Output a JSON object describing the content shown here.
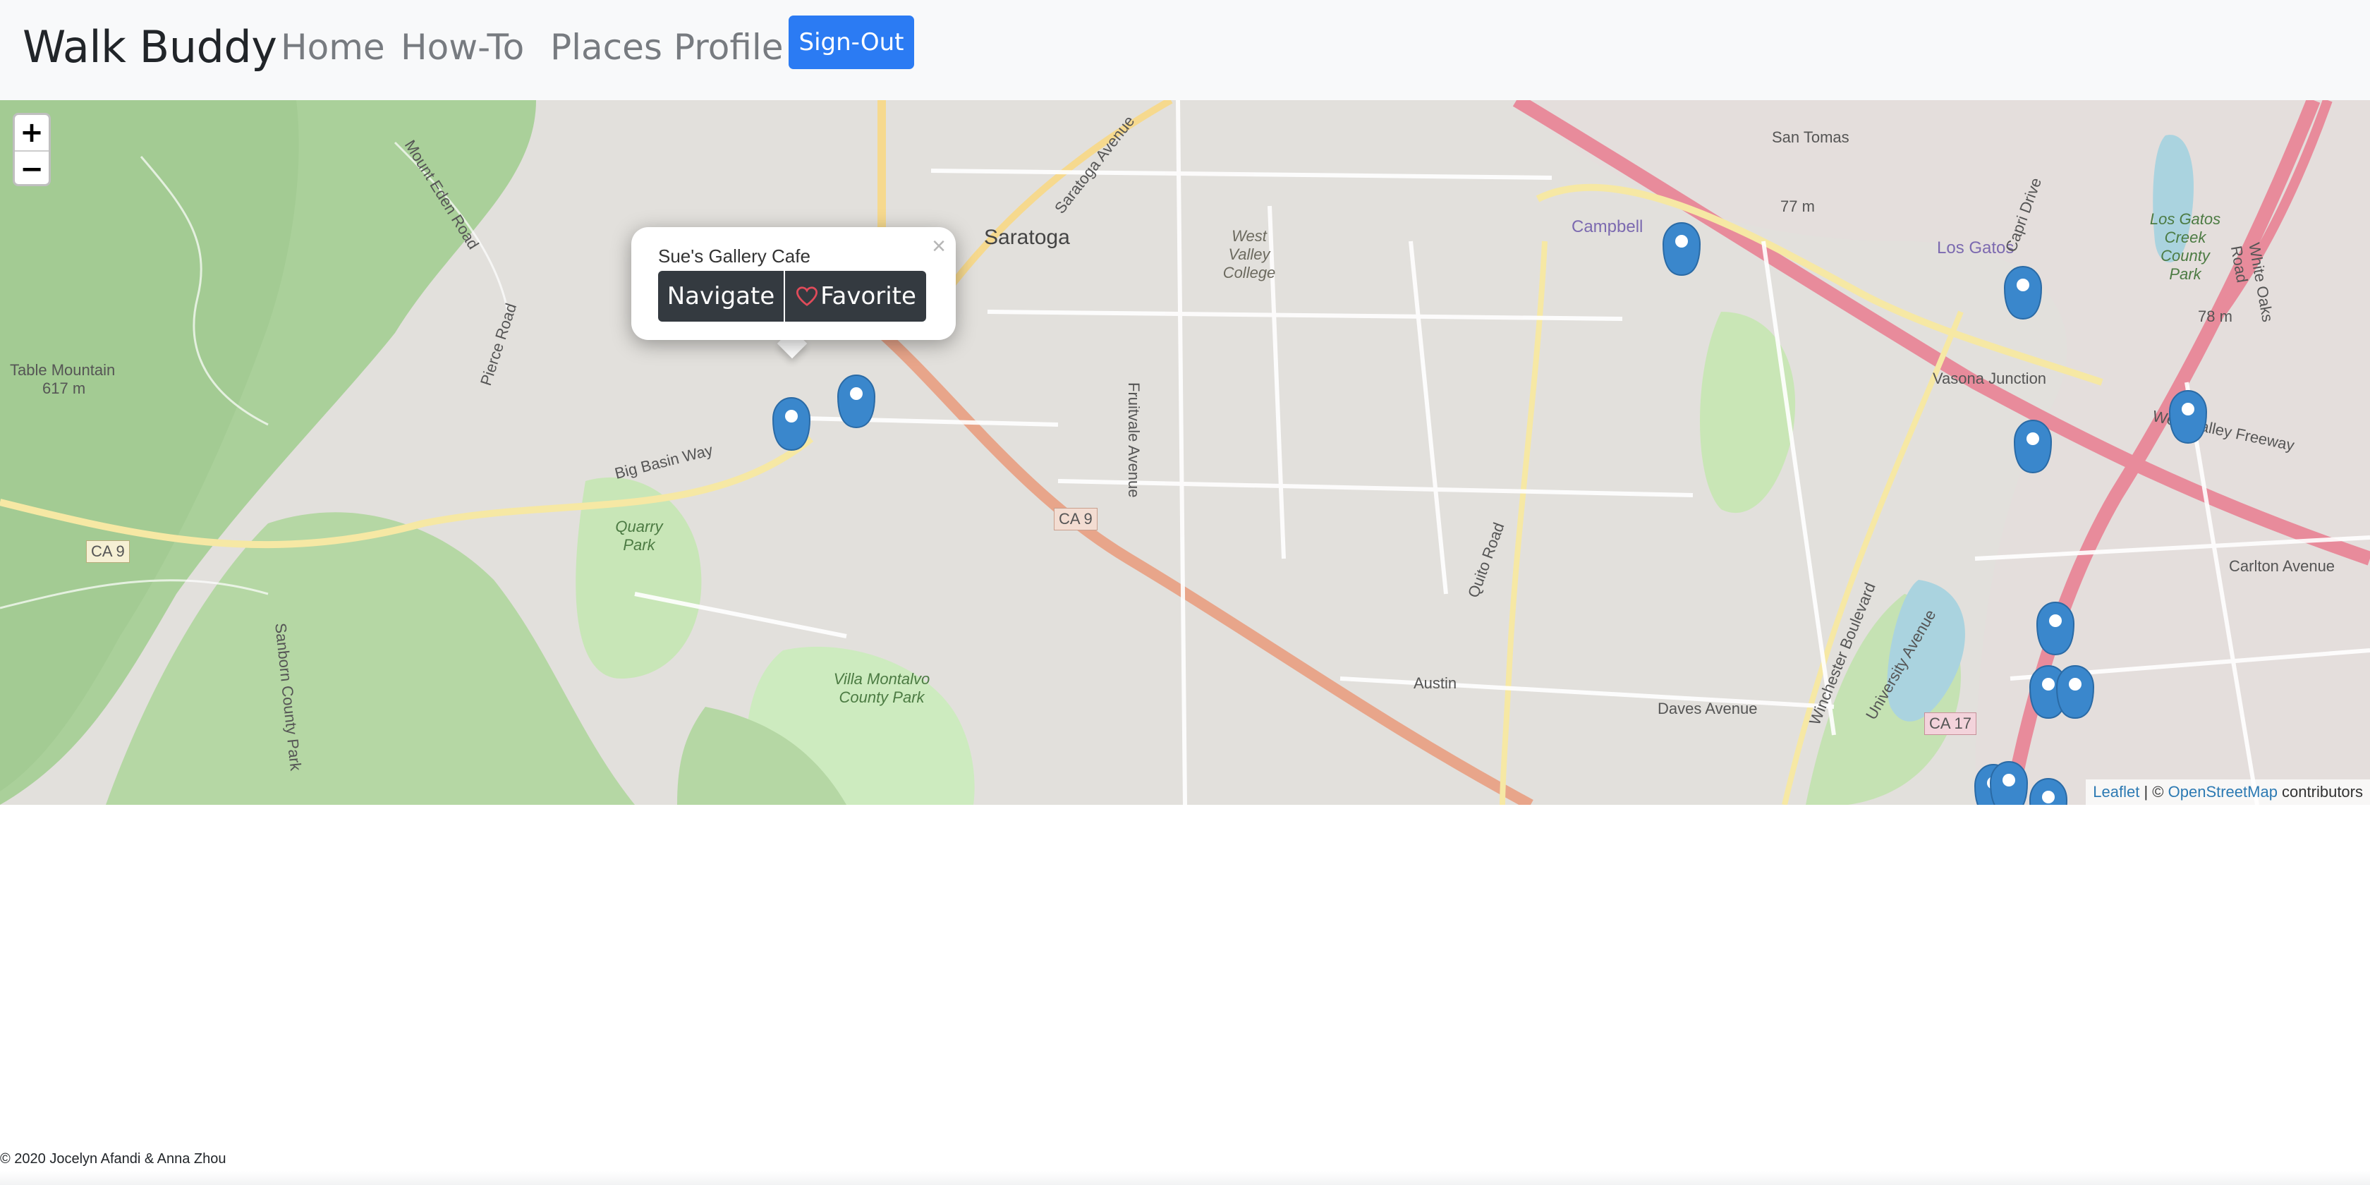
{
  "nav": {
    "brand": "Walk Buddy",
    "links": [
      "Home",
      "How-To",
      "Places",
      "Profile"
    ],
    "signout": "Sign-Out"
  },
  "map": {
    "zoom_in": "+",
    "zoom_out": "−",
    "labels": {
      "saratoga": "Saratoga",
      "table_mountain": "Table Mountain",
      "table_mountain_elev": "617 m",
      "west_valley_college": "West Valley College",
      "quarry_park": "Quarry Park",
      "villa_montalvo": "Villa Montalvo County Park",
      "san_tomas": "San Tomas",
      "campbell": "Campbell",
      "los_gatos": "Los Gatos",
      "vasona_junction": "Vasona Junction",
      "los_gatos_creek_park": "Los Gatos Creek County Park",
      "austin": "Austin",
      "ca9": "CA 9",
      "ca9_west": "CA 9",
      "ca17": "CA 17",
      "daves_avenue": "Daves Avenue",
      "carlton_avenue": "Carlton Avenue",
      "fruitvale_avenue": "Fruitvale Avenue",
      "quito_road": "Quito Road",
      "winchester": "Winchester Boulevard",
      "big_basin_way": "Big Basin Way",
      "pierce_road": "Pierce Road",
      "mount_eden": "Mount Eden Road",
      "elev_77": "77 m",
      "elev_78": "78 m",
      "freeway": "West Valley Freeway",
      "sanborn": "Sanborn County Park",
      "saratoga_avenue": "Saratoga Avenue",
      "white_oaks": "White Oaks Road",
      "capri": "Capri Drive",
      "university": "University Avenue"
    },
    "popup": {
      "title": "Sue's Gallery Cafe",
      "navigate": "Navigate",
      "favorite": "Favorite",
      "close": "×"
    },
    "attribution": {
      "leaflet": "Leaflet",
      "sep": " | © ",
      "osm": "OpenStreetMap",
      "suffix": " contributors"
    }
  },
  "footer": "© 2020 Jocelyn Afandi & Anna Zhou",
  "colors": {
    "navbar_bg": "#f8f9fa",
    "signout_bg": "#2b7bf3",
    "popup_btn_bg": "#343a40",
    "marker": "#3a87cc",
    "heart": "#e04b5a"
  }
}
